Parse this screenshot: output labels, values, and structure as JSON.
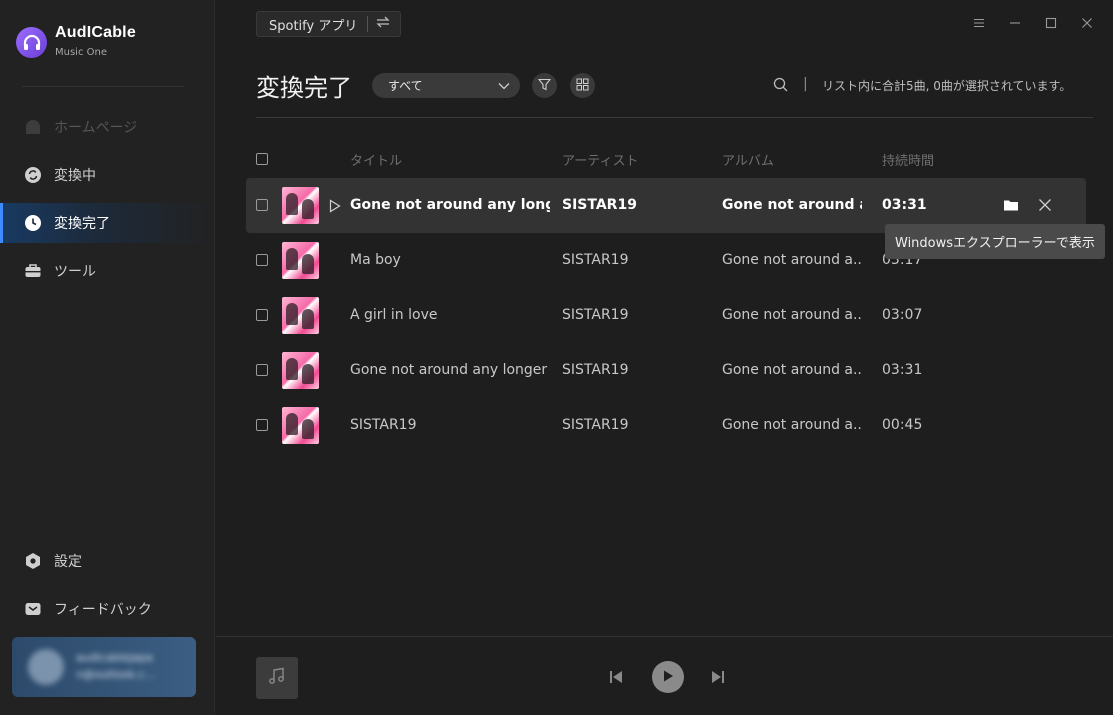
{
  "brand": {
    "name": "AudICable",
    "subtitle": "Music One"
  },
  "sidebar": {
    "items": [
      {
        "label": "ホームページ",
        "icon": "home-icon",
        "state": "disabled"
      },
      {
        "label": "変換中",
        "icon": "converting-icon",
        "state": "normal"
      },
      {
        "label": "変換完了",
        "icon": "clock-icon",
        "state": "active"
      },
      {
        "label": "ツール",
        "icon": "toolbox-icon",
        "state": "normal"
      }
    ],
    "bottom_items": [
      {
        "label": "設定",
        "icon": "settings-icon"
      },
      {
        "label": "フィードバック",
        "icon": "mail-icon"
      }
    ],
    "account": {
      "line1": "audicablejapa",
      "line2": "n@outlook.c..."
    }
  },
  "topbar": {
    "source_label": "Spotify アプリ",
    "switch_icon": "switch-icon"
  },
  "window_controls": [
    "menu-icon",
    "minimize-icon",
    "maximize-icon",
    "close-icon"
  ],
  "page": {
    "title": "変換完了",
    "filter_value": "すべて",
    "summary": "リスト内に合計5曲, 0曲が選択されています。",
    "separator": "|"
  },
  "table": {
    "headers": {
      "title": "タイトル",
      "artist": "アーティスト",
      "album": "アルバム",
      "duration": "持続時間"
    },
    "rows": [
      {
        "title": "Gone not around any longer...",
        "artist": "SISTAR19",
        "album": "Gone not around a...",
        "duration": "03:31",
        "hovered": true
      },
      {
        "title": "Ma boy",
        "artist": "SISTAR19",
        "album": "Gone not around a...",
        "duration": "03:17",
        "hovered": false
      },
      {
        "title": "A girl in love",
        "artist": "SISTAR19",
        "album": "Gone not around a...",
        "duration": "03:07",
        "hovered": false
      },
      {
        "title": "Gone not around any longer",
        "artist": "SISTAR19",
        "album": "Gone not around a...",
        "duration": "03:31",
        "hovered": false
      },
      {
        "title": "SISTAR19",
        "artist": "SISTAR19",
        "album": "Gone not around a...",
        "duration": "00:45",
        "hovered": false
      }
    ]
  },
  "tooltip": {
    "text": "Windowsエクスプローラーで表示"
  },
  "colors": {
    "accent": "#3d8bff",
    "brand": "#8a5cf0",
    "background": "#1e1e1e",
    "sidebar": "#222222"
  }
}
